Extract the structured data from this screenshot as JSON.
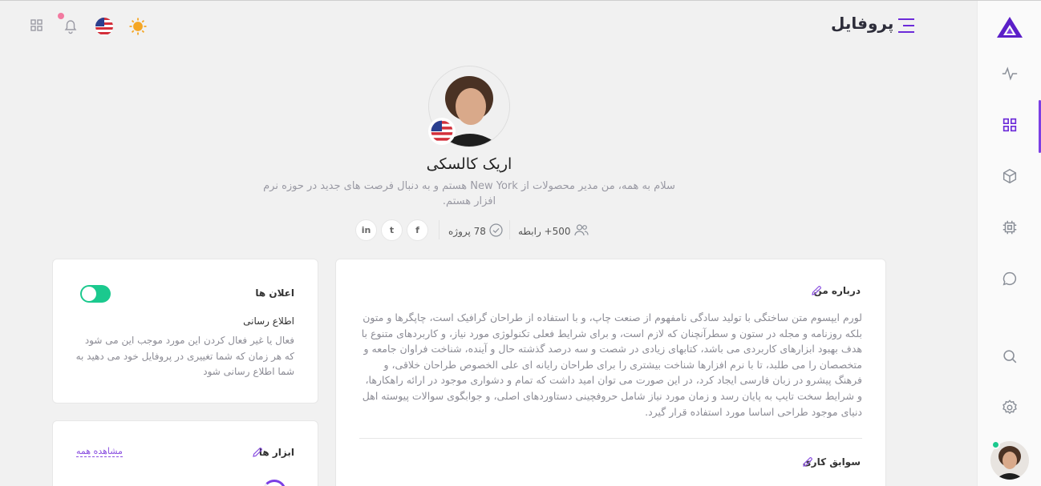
{
  "header": {
    "title": "پروفایل"
  },
  "profile": {
    "name": "اریک کالسکی",
    "bio": "سلام به همه، من مدیر محصولات از New York هستم و به دنبال فرصت های جدید در حوزه نرم افزار هستم.",
    "connections_label": "500+ رابطه",
    "projects_label": "78 پروژه",
    "social": [
      "in",
      "t",
      "f"
    ]
  },
  "notifications_card": {
    "title": "اعلان ها",
    "subtitle": "اطلاع رسانی",
    "description": "فعال یا غیر فعال کردن این مورد موجب این می شود که هر زمان که شما تغییری در پروفایل خود می دهید به شما اطلاع رسانی شود",
    "toggle_on": true
  },
  "tools_card": {
    "title": "ابزار ها",
    "view_all": "مشاهده همه"
  },
  "about_card": {
    "title": "درباره من",
    "text": "لورم ایپسوم متن ساختگی با تولید سادگی نامفهوم از صنعت چاپ، و با استفاده از طراحان گرافیک است، چاپگرها و متون بلکه روزنامه و مجله در ستون و سطرآنچنان که لازم است، و برای شرایط فعلی تکنولوژی مورد نیاز، و کاربردهای متنوع با هدف بهبود ابزارهای کاربردی می باشد، کتابهای زیادی در شصت و سه درصد گذشته حال و آینده، شناخت فراوان جامعه و متخصصان را می طلبد، تا با نرم افزارها شناخت بیشتری را برای طراحان رایانه ای علی الخصوص طراحان خلاقی، و فرهنگ پیشرو در زبان فارسی ایجاد کرد، در این صورت می توان امید داشت که تمام و دشواری موجود در ارائه راهکارها، و شرایط سخت تایپ به پایان رسد و زمان مورد نیاز شامل حروفچینی دستاوردهای اصلی، و جوابگوی سوالات پیوسته اهل دنیای موجود طراحی اساسا مورد استفاده قرار گیرد.",
    "work_title": "سوابق کاری"
  },
  "colors": {
    "accent": "#6c2bd9",
    "success": "#1bc98e",
    "notification_dot": "#f27aa0"
  },
  "icons": [
    "logo-icon",
    "activity-icon",
    "dashboard-icon",
    "box-icon",
    "chip-icon",
    "chat-icon",
    "search-icon",
    "settings-icon",
    "menu-icon",
    "sun-icon",
    "flag-icon",
    "bell-icon",
    "apps-icon",
    "users-icon",
    "check-circle-icon",
    "pencil-icon"
  ]
}
